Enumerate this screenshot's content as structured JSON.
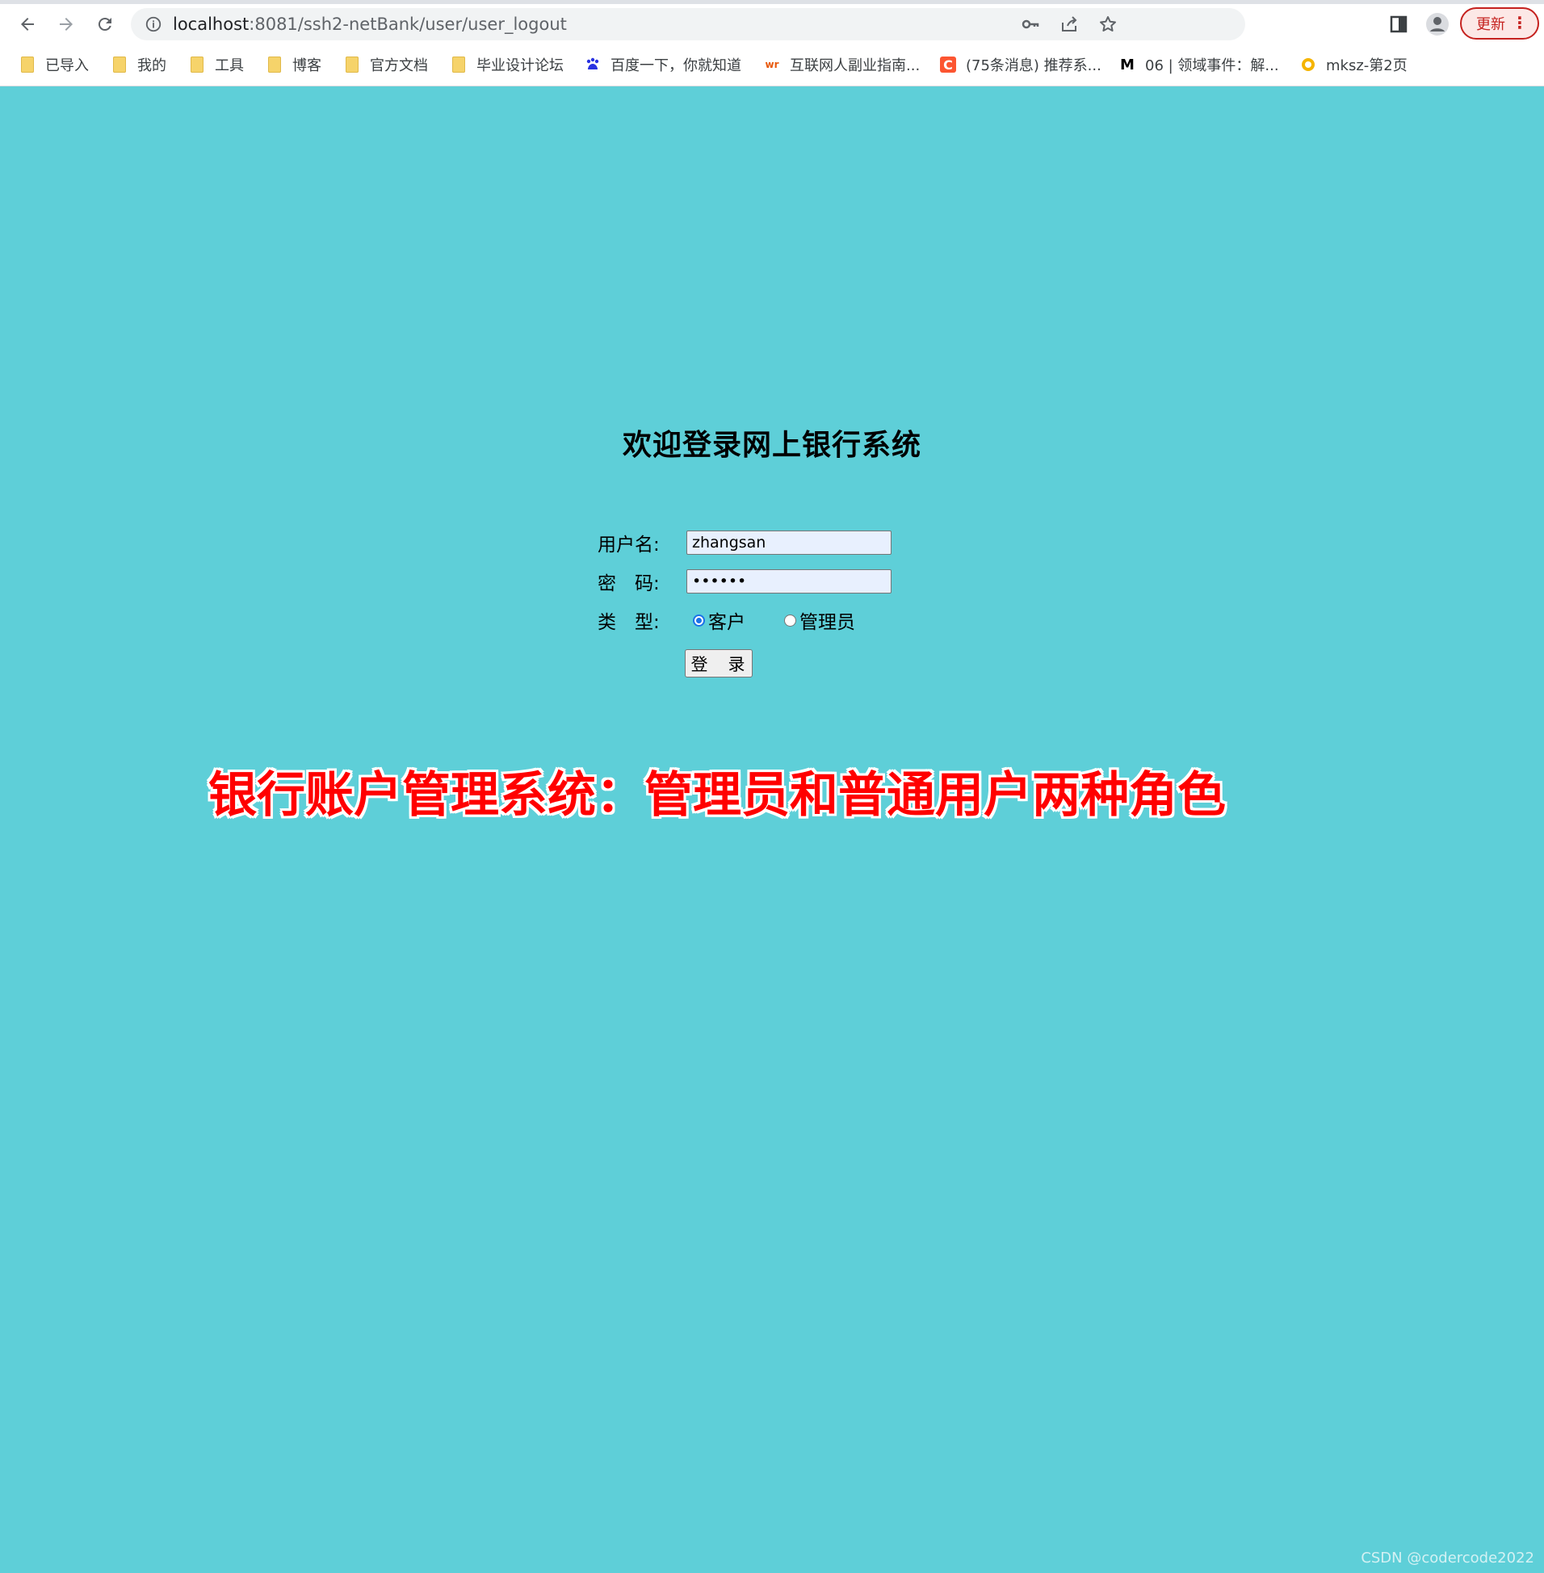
{
  "browser": {
    "url_host": "localhost",
    "url_rest": ":8081/ssh2-netBank/user/user_logout",
    "update_label": "更新",
    "bookmarks": [
      {
        "label": "已导入",
        "icon": "folder-icon"
      },
      {
        "label": "我的",
        "icon": "folder-icon"
      },
      {
        "label": "工具",
        "icon": "folder-icon"
      },
      {
        "label": "博客",
        "icon": "folder-icon"
      },
      {
        "label": "官方文档",
        "icon": "folder-icon"
      },
      {
        "label": "毕业设计论坛",
        "icon": "folder-icon"
      },
      {
        "label": "百度一下，你就知道",
        "icon": "baidu-icon"
      },
      {
        "label": "互联网人副业指南...",
        "icon": "wr-icon"
      },
      {
        "label": "(75条消息) 推荐系...",
        "icon": "csdn-icon"
      },
      {
        "label": "06 | 领域事件：解...",
        "icon": "m-icon"
      },
      {
        "label": "mksz-第2页",
        "icon": "mksz-icon"
      }
    ]
  },
  "login": {
    "title": "欢迎登录网上银行系统",
    "username_label": "用户名:",
    "username_value": "zhangsan",
    "password_label": "密　码:",
    "password_value": "••••••",
    "type_label": "类　型:",
    "role_options": [
      "客户",
      "管理员"
    ],
    "selected_role": "客户",
    "submit_label": "登　录"
  },
  "overlay": {
    "banner": "银行账户管理系统：管理员和普通用户两种角色",
    "watermark": "CSDN @codercode2022"
  },
  "colors": {
    "page_background": "#5ecfd8",
    "banner_text": "#ff0000",
    "update_button": "#c5221f"
  }
}
